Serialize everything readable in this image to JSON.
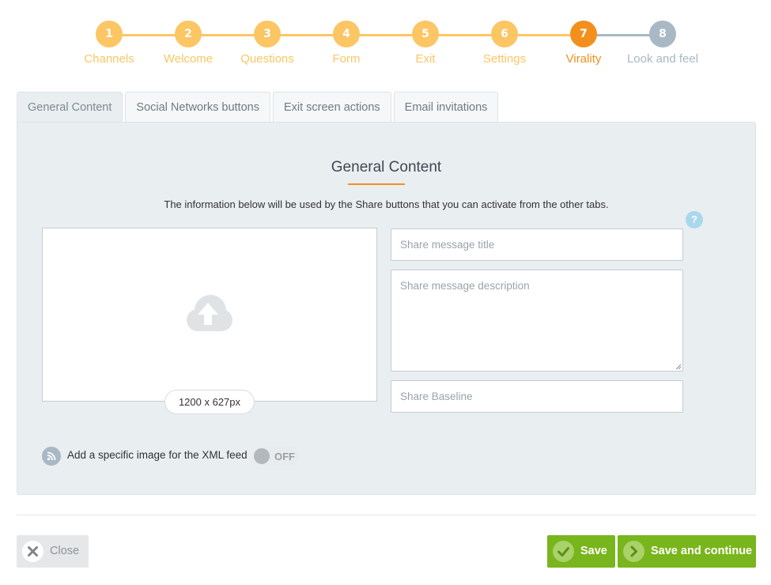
{
  "stepper": {
    "steps": [
      {
        "number": "1",
        "label": "Channels",
        "state": "done"
      },
      {
        "number": "2",
        "label": "Welcome",
        "state": "done"
      },
      {
        "number": "3",
        "label": "Questions",
        "state": "done"
      },
      {
        "number": "4",
        "label": "Form",
        "state": "done"
      },
      {
        "number": "5",
        "label": "Exit",
        "state": "done"
      },
      {
        "number": "6",
        "label": "Settings",
        "state": "done"
      },
      {
        "number": "7",
        "label": "Virality",
        "state": "active"
      },
      {
        "number": "8",
        "label": "Look and feel",
        "state": "todo"
      }
    ],
    "colors": {
      "done": "#fcc665",
      "active": "#f3901d",
      "todo": "#a8b8c5"
    }
  },
  "tabs": [
    {
      "label": "General Content",
      "active": true
    },
    {
      "label": "Social Networks buttons",
      "active": false
    },
    {
      "label": "Exit screen actions",
      "active": false
    },
    {
      "label": "Email invitations",
      "active": false
    }
  ],
  "panel": {
    "title": "General Content",
    "description": "The information below will be used by the Share buttons that you can activate from the other tabs.",
    "help_icon": "?",
    "upload": {
      "icon": "cloud-upload-icon",
      "size_hint": "1200 x 627px"
    },
    "fields": {
      "title": {
        "placeholder": "Share message title",
        "value": ""
      },
      "description": {
        "placeholder": "Share message description",
        "value": ""
      },
      "baseline": {
        "placeholder": "Share Baseline",
        "value": ""
      }
    },
    "xml_feed": {
      "icon": "rss-icon",
      "label": "Add a specific image for the XML feed",
      "toggle": "OFF"
    }
  },
  "footer": {
    "close_label": "Close",
    "save_label": "Save",
    "save_continue_label": "Save and continue",
    "accent": "#79b51c"
  }
}
